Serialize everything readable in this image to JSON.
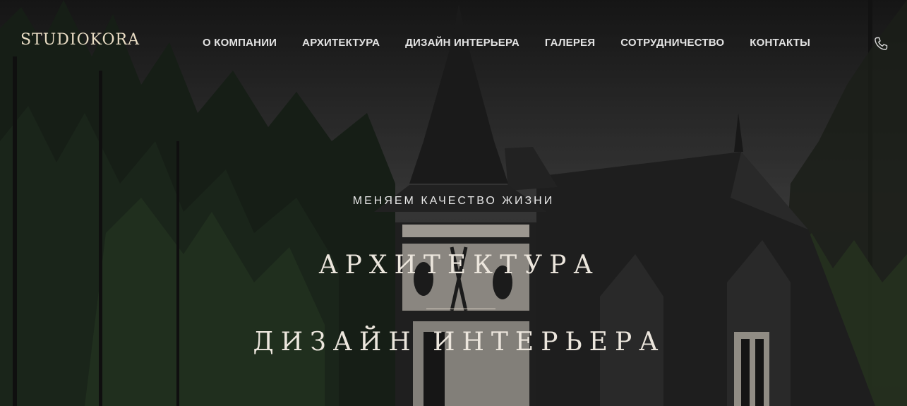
{
  "brand": {
    "logo_text": "STUDIOKORA",
    "logo_color": "#e9dcc4"
  },
  "nav": {
    "items": [
      {
        "label": "О КОМПАНИИ"
      },
      {
        "label": "АРХИТЕКТУРА"
      },
      {
        "label": "ДИЗАЙН ИНТЕРЬЕРА"
      },
      {
        "label": "ГАЛЕРЕЯ"
      },
      {
        "label": "СОТРУДНИЧЕСТВО"
      },
      {
        "label": "КОНТАКТЫ"
      }
    ],
    "phone_icon": "phone-icon"
  },
  "hero": {
    "tagline": "МЕНЯЕМ КАЧЕСТВО ЖИЗНИ",
    "title_architecture": "АРХИТЕКТУРА",
    "title_interior": "ДИЗАЙН ИНТЕРЬЕРА"
  },
  "colors": {
    "accent_text": "#ece6dd",
    "nav_text": "#e3e3e3"
  }
}
